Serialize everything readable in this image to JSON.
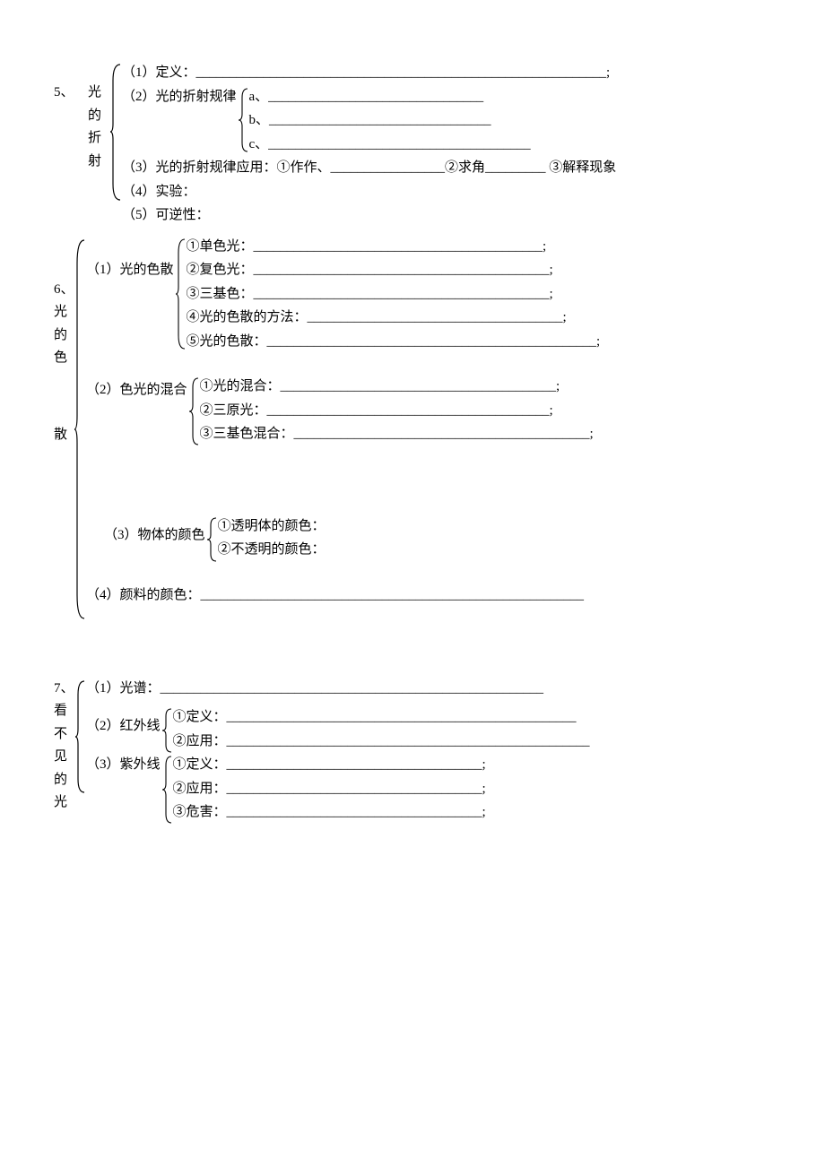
{
  "s5": {
    "num": "5、",
    "title_chars": [
      "光",
      "的",
      "折",
      "射"
    ],
    "i1": "（1）定义：_____________________________________________________________;",
    "i2": "（2）光的折射规律",
    "i2a": "a、________________________________",
    "i2b": "b、_________________________________",
    "i2c": "c、_______________________________________",
    "i3": "（3）光的折射规律应用：①作作、_________________②求角_________  ③解释现象",
    "i4": "（4）实验：",
    "i5": "（5）可逆性："
  },
  "s6": {
    "num": "6、",
    "title_chars": [
      "光",
      "的",
      "色"
    ],
    "title_chars2": [
      "散"
    ],
    "g1label": "（1）光的色散",
    "g1_1": "①单色光：___________________________________________;",
    "g1_2": "②复色光：____________________________________________;",
    "g1_3": "③三基色：____________________________________________;",
    "g1_4": "④光的色散的方法：______________________________________;",
    "g1_5": "⑤光的色散：_________________________________________________;",
    "g2label": "（2）色光的混合",
    "g2_1": "①光的混合：_________________________________________;",
    "g2_2": "②三原光：__________________________________________;",
    "g2_3": "③三基色混合：____________________________________________;",
    "g3label": "（3）物体的颜色",
    "g3_1": "①透明体的颜色：",
    "g3_2": "②不透明的颜色：",
    "g4": "（4）颜料的颜色：_________________________________________________________"
  },
  "s7": {
    "num": "7、",
    "title_chars": [
      "看",
      "不",
      "见",
      "的",
      "光"
    ],
    "i1": "（1）光谱：_________________________________________________________",
    "g2label": "（2）红外线",
    "g2_1": "①定义：____________________________________________________",
    "g2_2": "②应用：______________________________________________________",
    "g3label": "（3）紫外线",
    "g3_1": "①定义：______________________________________;",
    "g3_2": "②应用：______________________________________;",
    "g3_3": "③危害：______________________________________;"
  }
}
